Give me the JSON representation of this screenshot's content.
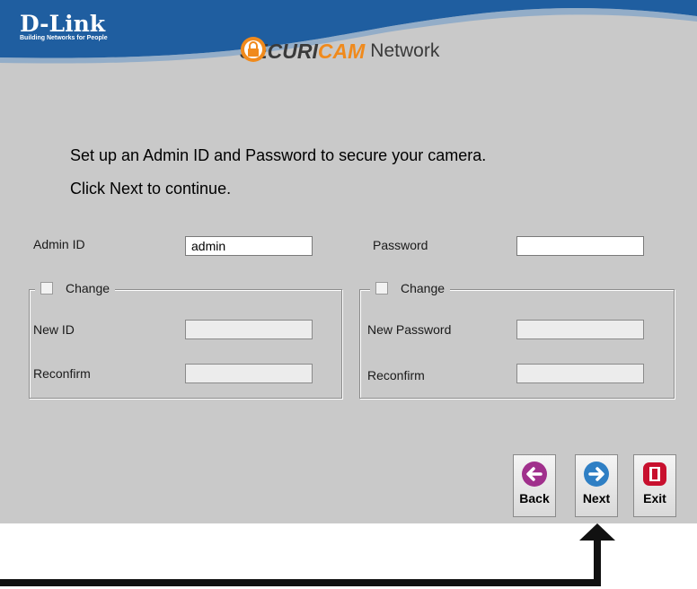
{
  "header": {
    "logo_main": "D-Link",
    "logo_tagline": "Building Networks for People",
    "brand_part1": "SECURI",
    "brand_part2": "CAM",
    "brand_part3": "Network",
    "colors": {
      "banner": "#1f5ea0",
      "accent": "#f08a1c"
    }
  },
  "instructions": {
    "line1": "Set up an Admin ID and Password to secure your camera.",
    "line2": "Click Next to continue."
  },
  "form": {
    "admin_id_label": "Admin ID",
    "admin_id_value": "admin",
    "password_label": "Password",
    "password_value": "",
    "left_group": {
      "change_label": "Change",
      "new_label": "New ID",
      "reconfirm_label": "Reconfirm"
    },
    "right_group": {
      "change_label": "Change",
      "new_label": "New Password",
      "reconfirm_label": "Reconfirm"
    }
  },
  "buttons": {
    "back": {
      "label": "Back",
      "icon": "left-arrow-icon",
      "color": "#a0308c"
    },
    "next": {
      "label": "Next",
      "icon": "right-arrow-icon",
      "color": "#2f7fc4"
    },
    "exit": {
      "label": "Exit",
      "icon": "exit-door-icon",
      "color": "#c8102e"
    }
  }
}
